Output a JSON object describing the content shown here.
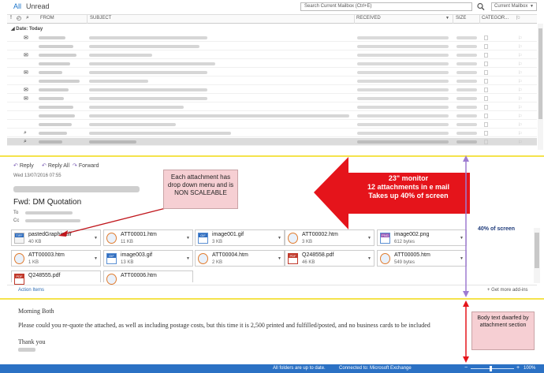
{
  "filters": {
    "all": "All",
    "unread": "Unread"
  },
  "search": {
    "placeholder": "Search Current Mailbox (Ctrl+E)",
    "scope": "Current Mailbox"
  },
  "columns": {
    "from": "FROM",
    "subject": "SUBJECT",
    "received": "RECEIVED",
    "size": "SIZE",
    "categories": "CATEGOR..."
  },
  "group_header": "Date: Today",
  "reading_pane": {
    "reply": "Reply",
    "reply_all": "Reply All",
    "forward": "Forward",
    "date": "Wed 13/07/2016 07:55",
    "subject": "Fwd: DM Quotation",
    "to_label": "To",
    "cc_label": "Cc"
  },
  "attachments": [
    {
      "name": "pastedGraphic.tiff",
      "size": "40 KB",
      "icon": "tiff-file-icon"
    },
    {
      "name": "ATT00001.htm",
      "size": "11 KB",
      "icon": "htm-file-icon"
    },
    {
      "name": "image001.gif",
      "size": "3 KB",
      "icon": "gif-file-icon"
    },
    {
      "name": "ATT00002.htm",
      "size": "3 KB",
      "icon": "htm-file-icon"
    },
    {
      "name": "image002.png",
      "size": "612 bytes",
      "icon": "png-file-icon"
    },
    {
      "name": "ATT00003.htm",
      "size": "1 KB",
      "icon": "htm-file-icon"
    },
    {
      "name": "image003.gif",
      "size": "13 KB",
      "icon": "gif-file-icon"
    },
    {
      "name": "ATT00004.htm",
      "size": "2 KB",
      "icon": "htm-file-icon"
    },
    {
      "name": "Q248558.pdf",
      "size": "46 KB",
      "icon": "pdf-file-icon"
    },
    {
      "name": "ATT00005.htm",
      "size": "549 bytes",
      "icon": "htm-file-icon"
    },
    {
      "name": "Q248555.pdf",
      "size": "",
      "icon": "pdf-file-icon"
    },
    {
      "name": "ATT00006.htm",
      "size": "",
      "icon": "htm-file-icon"
    }
  ],
  "action_items": "Action Items",
  "get_addins": "Get more add-ins",
  "body": {
    "greeting": "Morning Both",
    "paragraph": "Please could you re-quote the attached, as well as including postage costs, but this time it is 2,500 printed and fulfilled/posted, and no business cards to be included",
    "closing": "Thank you"
  },
  "status": {
    "sync": "All folders are up to date.",
    "connection": "Connected to: Microsoft Exchange",
    "zoom": "100%"
  },
  "annotations": {
    "attachments_note": "Each attachment has drop down menu and is NON SCALEABLE",
    "monitor_line1": "23\" monitor",
    "monitor_line2": "12 attachments in e mail",
    "monitor_line3": "Takes up 40% of screen",
    "forty_percent": "40% of screen",
    "body_note": "Body text dwarfed by attachment section"
  },
  "colors": {
    "accent": "#2b71c4",
    "annotation_red": "#e5141b",
    "annotation_purple": "#9d7bd1",
    "note_bg": "#f6cfd3"
  }
}
